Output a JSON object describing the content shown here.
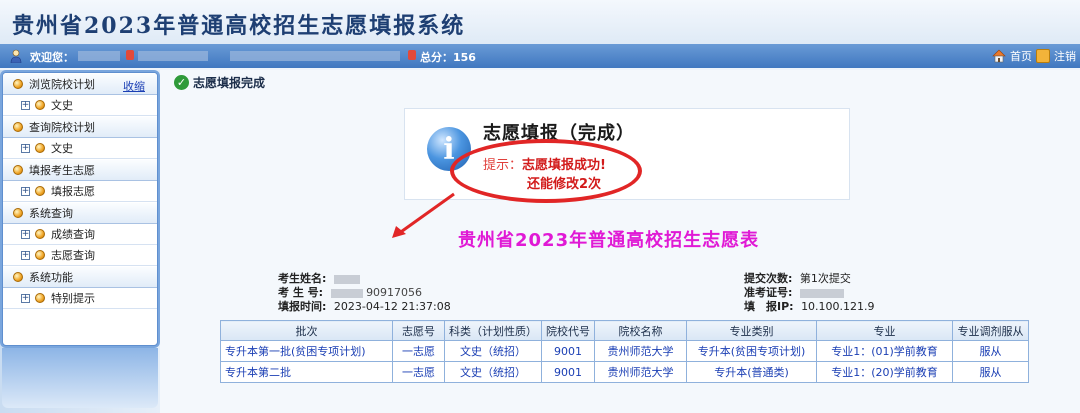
{
  "header": {
    "title": "贵州省2023年普通高校招生志愿填报系统"
  },
  "navbar": {
    "welcome": "欢迎您：",
    "score_label": "总分：",
    "score_value": "156",
    "home": "首页",
    "logout": "注销"
  },
  "sidebar": {
    "collapse_label": "收缩",
    "groups": [
      {
        "label": "浏览院校计划",
        "items": [
          "文史"
        ]
      },
      {
        "label": "查询院校计划",
        "items": [
          "文史"
        ]
      },
      {
        "label": "填报考生志愿",
        "items": [
          "填报志愿"
        ]
      },
      {
        "label": "系统查询",
        "items": [
          "成绩查询",
          "志愿查询"
        ]
      },
      {
        "label": "系统功能",
        "items": [
          "特别提示"
        ]
      }
    ]
  },
  "main": {
    "done_title": "志愿填报完成",
    "message": {
      "heading": "志愿填报（完成）",
      "hint_label": "提示：",
      "hint_text": "志愿填报成功!",
      "remaining": "还能修改2次"
    },
    "form_title": "贵州省2023年普通高校招生志愿表",
    "left_info": {
      "name_label": "考生姓名:",
      "id_label": "考 生 号:",
      "id_value_suffix": "90917056",
      "time_label": "填报时间:",
      "time_value": "2023-04-12 21:37:08"
    },
    "right_info": {
      "submit_label": "提交次数:",
      "submit_value": "第1次提交",
      "cert_label": "准考证号:",
      "ip_label": "填　报IP:",
      "ip_value": "10.100.121.9"
    },
    "table": {
      "headers": [
        "批次",
        "志愿号",
        "科类（计划性质）",
        "院校代号",
        "院校名称",
        "专业类别",
        "专业",
        "专业调剂服从"
      ],
      "rows": [
        [
          "专升本第一批(贫困专项计划)",
          "一志愿",
          "文史（统招）",
          "9001",
          "贵州师范大学",
          "专升本(贫困专项计划)",
          "专业1：(01)学前教育",
          "服从"
        ],
        [
          "专升本第二批",
          "一志愿",
          "文史（统招）",
          "9001",
          "贵州师范大学",
          "专升本(普通类)",
          "专业1：(20)学前教育",
          "服从"
        ]
      ]
    }
  },
  "colors": {
    "header_title": "#1e3f73",
    "navbar": "#3f77c0",
    "highlight_red": "#e12626",
    "form_title": "#e019d5",
    "link_blue": "#1b3fb4"
  }
}
